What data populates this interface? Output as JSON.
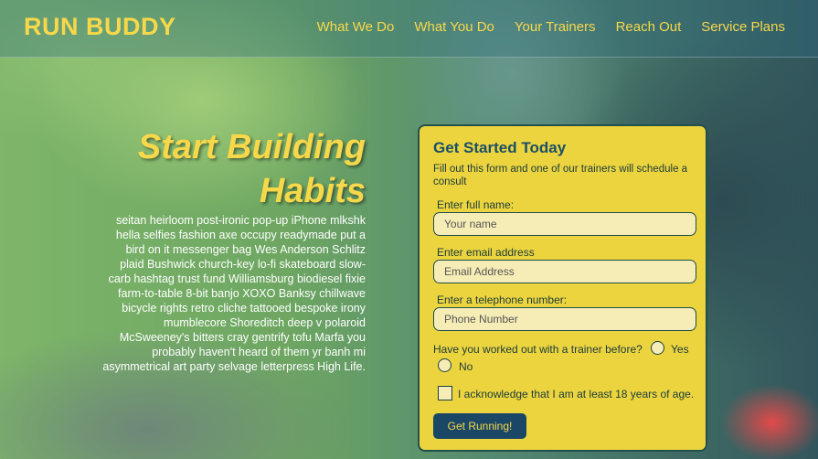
{
  "brand": {
    "name": "RUN BUDDY"
  },
  "nav": {
    "items": [
      "What We Do",
      "What You Do",
      "Your Trainers",
      "Reach Out",
      "Service Plans"
    ]
  },
  "hero": {
    "title": "Start Building Habits",
    "body": "seitan heirloom post-ironic pop-up iPhone mlkshk hella selfies fashion axe occupy readymade put a bird on it messenger bag Wes Anderson Schlitz plaid Bushwick church-key lo-fi skateboard slow-carb hashtag trust fund Williamsburg biodiesel fixie farm-to-table 8-bit banjo XOXO Banksy chillwave bicycle rights retro cliche tattooed bespoke irony mumblecore Shoreditch deep v polaroid McSweeney's bitters cray gentrify tofu Marfa you probably haven't heard of them yr banh mi asymmetrical art party selvage letterpress High Life."
  },
  "form": {
    "title": "Get Started Today",
    "description": "Fill out this form and one of our trainers will schedule a consult",
    "name_label": "Enter full name:",
    "name_placeholder": "Your name",
    "email_label": "Enter email address",
    "email_placeholder": "Email Address",
    "phone_label": "Enter a telephone number:",
    "phone_placeholder": "Phone Number",
    "trainer_question": "Have you worked out with a trainer before?",
    "yes_label": "Yes",
    "no_label": "No",
    "age_ack": "I acknowledge that I am at least 18 years of age.",
    "submit_label": "Get Running!"
  },
  "colors": {
    "accent_yellow": "#f7d84a",
    "card_yellow": "#ecd43f",
    "dark_teal": "#1a4f66",
    "button_blue": "#1a4766"
  }
}
